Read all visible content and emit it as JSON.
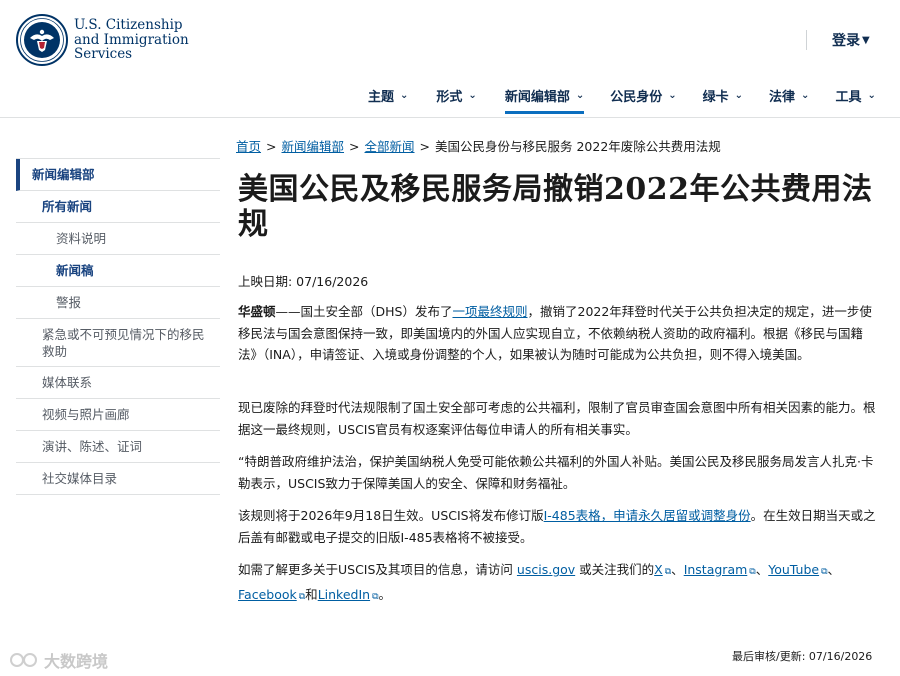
{
  "header": {
    "brand_line1": "U.S. Citizenship",
    "brand_line2": "and Immigration",
    "brand_line3": "Services",
    "login_label": "登录",
    "nav": [
      {
        "label": "主题"
      },
      {
        "label": "形式"
      },
      {
        "label": "新闻编辑部"
      },
      {
        "label": "公民身份"
      },
      {
        "label": "绿卡"
      },
      {
        "label": "法律"
      },
      {
        "label": "工具"
      }
    ]
  },
  "sidebar": {
    "items": [
      {
        "label": "新闻编辑部"
      },
      {
        "label": "所有新闻"
      },
      {
        "label": "资料说明"
      },
      {
        "label": "新闻稿"
      },
      {
        "label": "警报"
      },
      {
        "label": "紧急或不可预见情况下的移民救助"
      },
      {
        "label": "媒体联系"
      },
      {
        "label": "视频与照片画廊"
      },
      {
        "label": "演讲、陈述、证词"
      },
      {
        "label": "社交媒体目录"
      }
    ]
  },
  "breadcrumb": {
    "home": "首页",
    "newsroom": "新闻编辑部",
    "all_news": "全部新闻",
    "current": "美国公民身份与移民服务 2022年废除公共费用法规",
    "separator": ">"
  },
  "article": {
    "title": "美国公民及移民服务局撤销2022年公共费用法规",
    "posted": "上映日期: 07/16/2026",
    "p1_lead": "华盛顿",
    "p1_a": "——国土安全部（DHS）发布了",
    "p1_link": "一项最终规则",
    "p1_b": "，撤销了2022年拜登时代关于公共负担决定的规定，进一步使移民法与国会意图保持一致，即美国境内的外国人应实现自立，不依赖纳税人资助的政府福利。根据《移民与国籍法》（INA），申请签证、入境或身份调整的个人，如果被认为随时可能成为公共负担，则不得入境美国。",
    "p2": "现已废除的拜登时代法规限制了国土安全部可考虑的公共福利，限制了官员审查国会意图中所有相关因素的能力。根据这一最终规则，USCIS官员有权逐案评估每位申请人的所有相关事实。",
    "p3": "“特朗普政府维护法治，保护美国纳税人免受可能依赖公共福利的外国人补贴。美国公民及移民服务局发言人扎克·卡勒表示，USCIS致力于保障美国人的安全、保障和财务福祉。",
    "p4_a": "该规则将于2026年9月18日生效。USCIS将发布修订版",
    "p4_link": "I-485表格，申请永久居留或调整身份",
    "p4_b": "。在生效日期当天或之后盖有邮戳或电子提交的旧版I-485表格将不被接受。",
    "p5_a": "如需了解更多关于USCIS及其项目的信息，请访问 ",
    "p5_link_site": "uscis.gov",
    "p5_b": " 或关注我们的",
    "p5_link_x": "X",
    "p5_sep1": "、",
    "p5_link_ig": "Instagram",
    "p5_sep2": "、",
    "p5_link_yt": "YouTube",
    "p5_sep3": "、",
    "p5_link_fb": "Facebook",
    "p5_and": "和",
    "p5_link_li": "LinkedIn",
    "p5_end": "。"
  },
  "footer": {
    "updated": "最后审核/更新:   07/16/2026"
  },
  "watermark": {
    "text": "大数跨境"
  },
  "icons": {
    "seal": "dhs-seal-icon",
    "login_caret": "caret-down-icon",
    "nav_chevron": "chevron-down-icon",
    "external": "external-link-icon"
  },
  "colors": {
    "brand": "#003366",
    "link": "#005ea2",
    "nav_text": "#112e51",
    "active_underline": "#0b6ebf",
    "sidebar_accent": "#1a4480"
  }
}
